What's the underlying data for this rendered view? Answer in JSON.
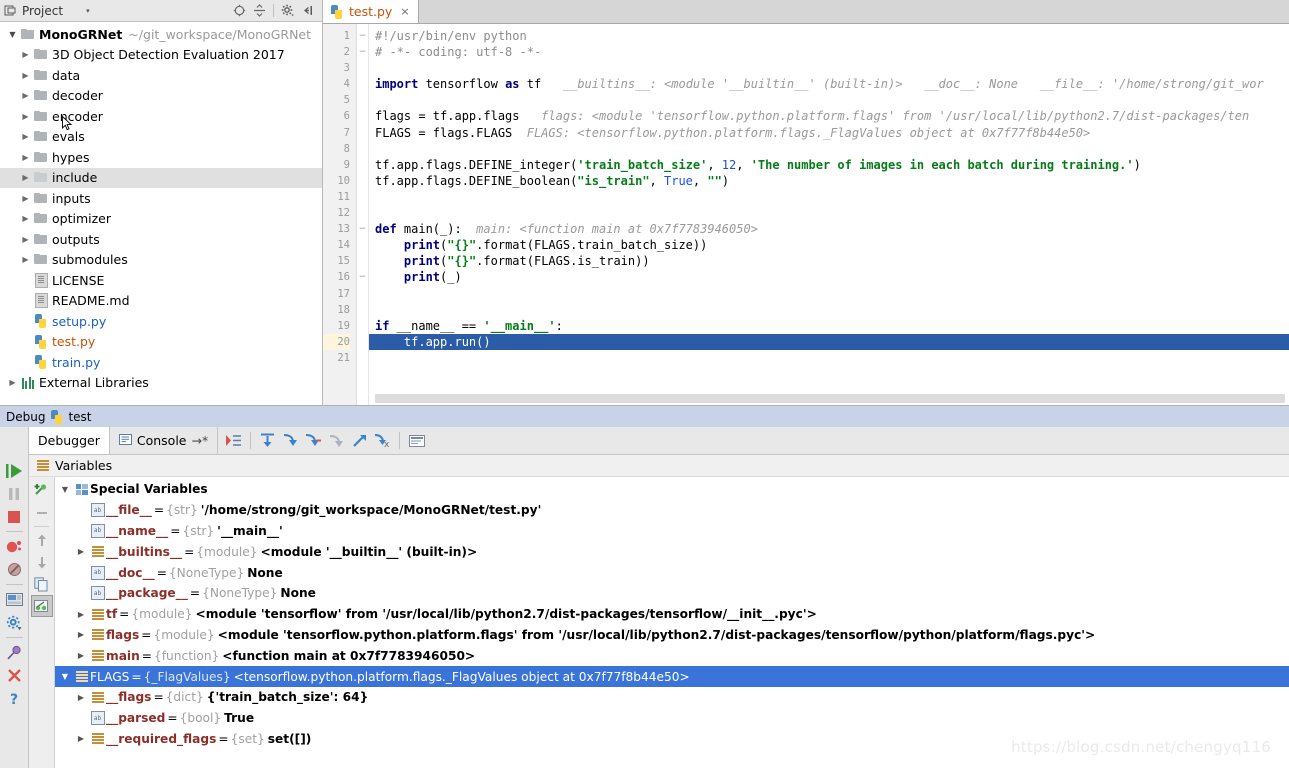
{
  "project_panel": {
    "header": {
      "title": "Project",
      "dropdown_caret": "▾",
      "icons": [
        "collapse-target-icon",
        "expand-collapse-icon",
        "gear-icon",
        "hide-icon"
      ]
    },
    "tree": [
      {
        "label": "MonoGRNet",
        "note": "~/git_workspace/MonoGRNet",
        "depth": 0,
        "arrow": "down",
        "icon": "folder-icon",
        "bold": true,
        "selected": false
      },
      {
        "label": "3D Object Detection Evaluation 2017",
        "note": "",
        "depth": 1,
        "arrow": "right",
        "icon": "folder-icon",
        "bold": false,
        "selected": false
      },
      {
        "label": "data",
        "note": "",
        "depth": 1,
        "arrow": "right",
        "icon": "folder-icon",
        "bold": false,
        "selected": false
      },
      {
        "label": "decoder",
        "note": "",
        "depth": 1,
        "arrow": "right",
        "icon": "folder-icon",
        "bold": false,
        "selected": false
      },
      {
        "label": "encoder",
        "note": "",
        "depth": 1,
        "arrow": "right",
        "icon": "folder-icon",
        "bold": false,
        "selected": false
      },
      {
        "label": "evals",
        "note": "",
        "depth": 1,
        "arrow": "right",
        "icon": "folder-icon",
        "bold": false,
        "selected": false
      },
      {
        "label": "hypes",
        "note": "",
        "depth": 1,
        "arrow": "right",
        "icon": "folder-icon",
        "bold": false,
        "selected": false
      },
      {
        "label": "include",
        "note": "",
        "depth": 1,
        "arrow": "right",
        "icon": "folder-icon",
        "bold": false,
        "selected": true
      },
      {
        "label": "inputs",
        "note": "",
        "depth": 1,
        "arrow": "right",
        "icon": "folder-icon",
        "bold": false,
        "selected": false
      },
      {
        "label": "optimizer",
        "note": "",
        "depth": 1,
        "arrow": "right",
        "icon": "folder-icon",
        "bold": false,
        "selected": false
      },
      {
        "label": "outputs",
        "note": "",
        "depth": 1,
        "arrow": "right",
        "icon": "folder-icon",
        "bold": false,
        "selected": false
      },
      {
        "label": "submodules",
        "note": "",
        "depth": 1,
        "arrow": "right",
        "icon": "folder-icon",
        "bold": false,
        "selected": false
      },
      {
        "label": "LICENSE",
        "note": "",
        "depth": 1,
        "arrow": "none",
        "icon": "file-icon",
        "bold": false,
        "selected": false
      },
      {
        "label": "README.md",
        "note": "",
        "depth": 1,
        "arrow": "none",
        "icon": "file-icon",
        "bold": false,
        "selected": false
      },
      {
        "label": "setup.py",
        "note": "",
        "depth": 1,
        "arrow": "none",
        "icon": "python-file-icon",
        "bold": false,
        "selected": false,
        "color": "blue"
      },
      {
        "label": "test.py",
        "note": "",
        "depth": 1,
        "arrow": "none",
        "icon": "python-file-icon",
        "bold": false,
        "selected": false,
        "color": "orange"
      },
      {
        "label": "train.py",
        "note": "",
        "depth": 1,
        "arrow": "none",
        "icon": "python-file-icon",
        "bold": false,
        "selected": false,
        "color": "blue"
      },
      {
        "label": "External Libraries",
        "note": "",
        "depth": 0,
        "arrow": "right",
        "icon": "library-icon",
        "bold": false,
        "selected": false
      }
    ]
  },
  "editor": {
    "tab": {
      "label": "test.py",
      "close": "×",
      "icon": "python-file-icon"
    },
    "current_line": 20,
    "lines": [
      {
        "n": 1,
        "fold": "−",
        "tokens": [
          {
            "t": "#!/usr/bin/env python",
            "c": "cmt"
          }
        ]
      },
      {
        "n": 2,
        "fold": "−",
        "tokens": [
          {
            "t": "# -*- coding: utf-8 -*-",
            "c": "cmt"
          }
        ]
      },
      {
        "n": 3,
        "fold": "",
        "tokens": []
      },
      {
        "n": 4,
        "fold": "",
        "tokens": [
          {
            "t": "import",
            "c": "kw"
          },
          {
            "t": " tensorflow ",
            "c": "plain"
          },
          {
            "t": "as",
            "c": "kw"
          },
          {
            "t": " tf",
            "c": "plain"
          },
          {
            "t": "   __builtins__: <module '__builtin__' (built-in)>   __doc__: None   __file__: '/home/strong/git_wor",
            "c": "inlay"
          }
        ]
      },
      {
        "n": 5,
        "fold": "",
        "tokens": []
      },
      {
        "n": 6,
        "fold": "",
        "tokens": [
          {
            "t": "flags = tf.app.flags",
            "c": "plain"
          },
          {
            "t": "   flags: <module 'tensorflow.python.platform.flags' from '/usr/local/lib/python2.7/dist-packages/ten",
            "c": "inlay"
          }
        ]
      },
      {
        "n": 7,
        "fold": "",
        "tokens": [
          {
            "t": "FLAGS = flags.FLAGS",
            "c": "plain"
          },
          {
            "t": "  FLAGS: <tensorflow.python.platform.flags._FlagValues object at 0x7f77f8b44e50>",
            "c": "inlay"
          }
        ]
      },
      {
        "n": 8,
        "fold": "",
        "tokens": []
      },
      {
        "n": 9,
        "fold": "",
        "tokens": [
          {
            "t": "tf.app.flags.DEFINE_integer(",
            "c": "plain"
          },
          {
            "t": "'train_batch_size'",
            "c": "str"
          },
          {
            "t": ", ",
            "c": "plain"
          },
          {
            "t": "12",
            "c": "num"
          },
          {
            "t": ", ",
            "c": "plain"
          },
          {
            "t": "'The number of images in each batch during training.'",
            "c": "str"
          },
          {
            "t": ")",
            "c": "plain"
          }
        ]
      },
      {
        "n": 10,
        "fold": "",
        "tokens": [
          {
            "t": "tf.app.flags.DEFINE_boolean(",
            "c": "plain"
          },
          {
            "t": "\"is_train\"",
            "c": "str"
          },
          {
            "t": ", ",
            "c": "plain"
          },
          {
            "t": "True",
            "c": "num"
          },
          {
            "t": ", ",
            "c": "plain"
          },
          {
            "t": "\"\"",
            "c": "str"
          },
          {
            "t": ")",
            "c": "plain"
          }
        ]
      },
      {
        "n": 11,
        "fold": "",
        "tokens": []
      },
      {
        "n": 12,
        "fold": "",
        "tokens": []
      },
      {
        "n": 13,
        "fold": "−",
        "tokens": [
          {
            "t": "def",
            "c": "kw"
          },
          {
            "t": " main(_):",
            "c": "plain"
          },
          {
            "t": "  main: <function main at 0x7f7783946050>",
            "c": "inlay"
          }
        ]
      },
      {
        "n": 14,
        "fold": "",
        "tokens": [
          {
            "t": "    ",
            "c": "plain"
          },
          {
            "t": "print",
            "c": "kw"
          },
          {
            "t": "(",
            "c": "plain"
          },
          {
            "t": "\"{}\"",
            "c": "str"
          },
          {
            "t": ".format(FLAGS.train_batch_size))",
            "c": "plain"
          }
        ]
      },
      {
        "n": 15,
        "fold": "",
        "tokens": [
          {
            "t": "    ",
            "c": "plain"
          },
          {
            "t": "print",
            "c": "kw"
          },
          {
            "t": "(",
            "c": "plain"
          },
          {
            "t": "\"{}\"",
            "c": "str"
          },
          {
            "t": ".format(FLAGS.is_train))",
            "c": "plain"
          }
        ]
      },
      {
        "n": 16,
        "fold": "−",
        "tokens": [
          {
            "t": "    ",
            "c": "plain"
          },
          {
            "t": "print",
            "c": "kw"
          },
          {
            "t": "(_)",
            "c": "plain"
          }
        ]
      },
      {
        "n": 17,
        "fold": "",
        "tokens": []
      },
      {
        "n": 18,
        "fold": "",
        "tokens": []
      },
      {
        "n": 19,
        "fold": "",
        "tokens": [
          {
            "t": "if",
            "c": "kw"
          },
          {
            "t": " __name__ == ",
            "c": "plain"
          },
          {
            "t": "'__main__'",
            "c": "str"
          },
          {
            "t": ":",
            "c": "plain"
          }
        ]
      },
      {
        "n": 20,
        "fold": "",
        "tokens": [
          {
            "t": "    tf.app.run()",
            "c": "cur-text"
          }
        ]
      },
      {
        "n": 21,
        "fold": "",
        "tokens": []
      }
    ]
  },
  "debug": {
    "title": "Debug",
    "session_name": "test",
    "tabs": [
      {
        "label": "Debugger",
        "active": true,
        "icon": "debugger-icon"
      },
      {
        "label": "Console",
        "active": false,
        "icon": "console-icon",
        "suffix": "→*"
      }
    ],
    "toolbar_icons": [
      "show-execution-point-icon",
      "step-over-icon",
      "step-into-icon",
      "force-step-into-icon",
      "step-out-icon",
      "run-to-cursor-icon",
      "evaluate-expression-icon",
      "frames-icon"
    ],
    "sidebar_icons": [
      "resume-program-icon",
      "pause-program-icon",
      "stop-icon",
      "view-breakpoints-icon",
      "mute-breakpoints-icon",
      "restore-layout-icon",
      "settings-gear-icon",
      "pin-tab-icon",
      "close-icon",
      "help-icon"
    ],
    "variables_panel": {
      "header": "Variables",
      "toolbar_icons": [
        "new-watch-icon",
        "remove-watch-icon",
        "move-up-icon",
        "move-down-icon",
        "copy-value-icon",
        "inspect-icon"
      ],
      "rows": [
        {
          "depth": 0,
          "arrow": "down",
          "icon": "special-variables-icon",
          "group": true,
          "name": "Special Variables",
          "type": "",
          "value": "",
          "selected": false
        },
        {
          "depth": 1,
          "arrow": "none",
          "icon": "str-icon",
          "name": "__file__",
          "type": "{str}",
          "value": "'/home/strong/git_workspace/MonoGRNet/test.py'",
          "selected": false
        },
        {
          "depth": 1,
          "arrow": "none",
          "icon": "str-icon",
          "name": "__name__",
          "type": "{str}",
          "value": "'__main__'",
          "selected": false
        },
        {
          "depth": 1,
          "arrow": "right",
          "icon": "module-icon",
          "name": "__builtins__",
          "type": "{module}",
          "value": "<module '__builtin__' (built-in)>",
          "selected": false
        },
        {
          "depth": 1,
          "arrow": "none",
          "icon": "str-icon",
          "name": "__doc__",
          "type": "{NoneType}",
          "value": "None",
          "selected": false
        },
        {
          "depth": 1,
          "arrow": "none",
          "icon": "str-icon",
          "name": "__package__",
          "type": "{NoneType}",
          "value": "None",
          "selected": false
        },
        {
          "depth": 1,
          "arrow": "right",
          "icon": "module-icon",
          "name": "tf",
          "type": "{module}",
          "value": "<module 'tensorflow' from '/usr/local/lib/python2.7/dist-packages/tensorflow/__init__.pyc'>",
          "selected": false
        },
        {
          "depth": 1,
          "arrow": "right",
          "icon": "module-icon",
          "name": "flags",
          "type": "{module}",
          "value": "<module 'tensorflow.python.platform.flags' from '/usr/local/lib/python2.7/dist-packages/tensorflow/python/platform/flags.pyc'>",
          "selected": false
        },
        {
          "depth": 1,
          "arrow": "right",
          "icon": "module-icon",
          "name": "main",
          "type": "{function}",
          "value": "<function main at 0x7f7783946050>",
          "selected": false
        },
        {
          "depth": 0,
          "arrow": "down",
          "icon": "module-icon",
          "name": "FLAGS",
          "type": "{_FlagValues}",
          "value": "<tensorflow.python.platform.flags._FlagValues object at 0x7f77f8b44e50>",
          "selected": true
        },
        {
          "depth": 1,
          "arrow": "right",
          "icon": "module-icon",
          "name": "__flags",
          "type": "{dict}",
          "value": "{'train_batch_size': 64}",
          "selected": false
        },
        {
          "depth": 1,
          "arrow": "none",
          "icon": "str-icon",
          "name": "__parsed",
          "type": "{bool}",
          "value": "True",
          "selected": false
        },
        {
          "depth": 1,
          "arrow": "right",
          "icon": "module-icon",
          "name": "__required_flags",
          "type": "{set}",
          "value": "set([])",
          "selected": false
        }
      ]
    }
  },
  "watermark": "https://blog.csdn.net/chengyq116",
  "colors": {
    "selection_blue": "#3a74d8",
    "editor_current_line": "#2b5ca8",
    "debug_title_bar": "#c9d3e8",
    "keyword": "#000080",
    "string": "#067d17",
    "number": "#1750eb",
    "comment": "#8c8c8c",
    "inlay_hint": "#9a9a9a",
    "variable_name": "#8b2f28",
    "type_label": "#a0a0a0",
    "python_orange": "#c9520a",
    "python_blue": "#1d5fbf"
  }
}
